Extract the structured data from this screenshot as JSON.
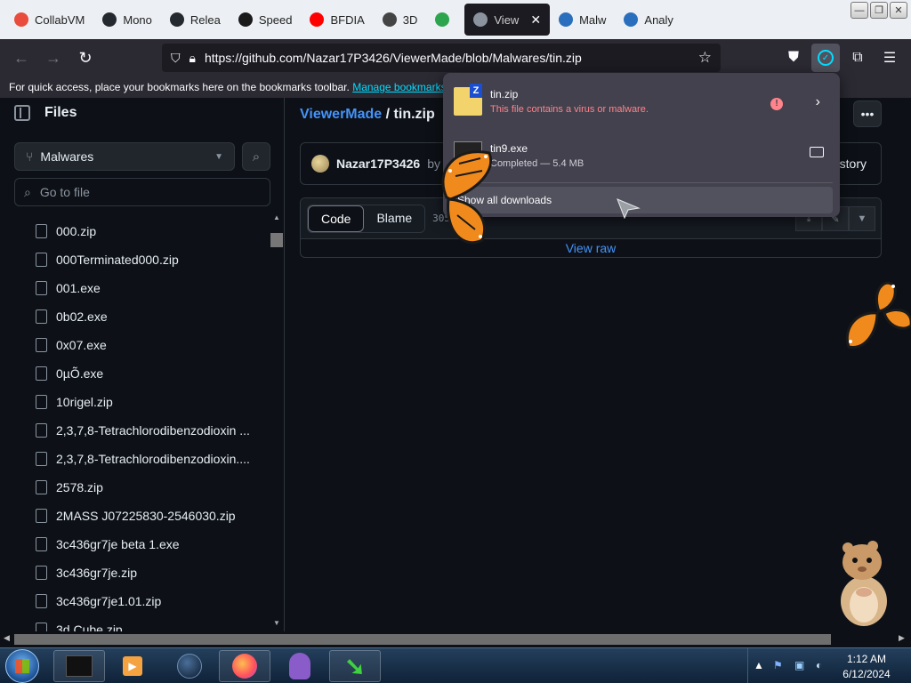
{
  "tabs": [
    {
      "label": "CollabVM",
      "color": "#e94b3c"
    },
    {
      "label": "Mono",
      "color": "#24292f"
    },
    {
      "label": "Relea",
      "color": "#24292f"
    },
    {
      "label": "Speed",
      "color": "#1a1a1a"
    },
    {
      "label": "BFDIA",
      "color": "#ff0000"
    },
    {
      "label": "3D",
      "color": "#444444"
    },
    {
      "label": "",
      "color": "#2da44e"
    },
    {
      "label": "View",
      "color": "#8b949e"
    },
    {
      "label": "Malw",
      "color": "#2a6fbd"
    },
    {
      "label": "Analy",
      "color": "#2a6fbd"
    }
  ],
  "active_tab_index": 7,
  "url": "https://github.com/Nazar17P3426/ViewerMade/blob/Malwares/tin.zip",
  "bookmarks_bar": {
    "text": "For quick access, place your bookmarks here on the bookmarks toolbar.",
    "link": "Manage bookmarks..."
  },
  "sidebar": {
    "title": "Files",
    "branch": "Malwares",
    "goto_placeholder": "Go to file",
    "files": [
      "000.zip",
      "000Terminated000.zip",
      "001.exe",
      "0b02.exe",
      "0x07.exe",
      "0µÕ.exe",
      "10rigel.zip",
      "2,3,7,8-Tetrachlorodibenzodioxin ...",
      "2,3,7,8-Tetrachlorodibenzodioxin....",
      "2578.zip",
      "2MASS J07225830-2546030.zip",
      "3c436gr7je beta 1.exe",
      "3c436gr7je.zip",
      "3c436gr7je1.01.zip",
      "3d Cube.zip"
    ]
  },
  "main": {
    "repo": "ViewerMade",
    "separator": " / ",
    "filename": "tin.zip",
    "author": "Nazar17P3426",
    "by": "by",
    "history": "History",
    "code_tab": "Code",
    "blame_tab": "Blame",
    "size": "305",
    "view_raw": "View raw"
  },
  "downloads": {
    "items": [
      {
        "name": "tin.zip",
        "status": "This file contains a virus or malware."
      },
      {
        "name": "tin9.exe",
        "status": "Completed — 5.4 MB"
      }
    ],
    "show_all": "Show all downloads"
  },
  "taskbar": {
    "time": "1:12 AM",
    "date": "6/12/2024"
  }
}
